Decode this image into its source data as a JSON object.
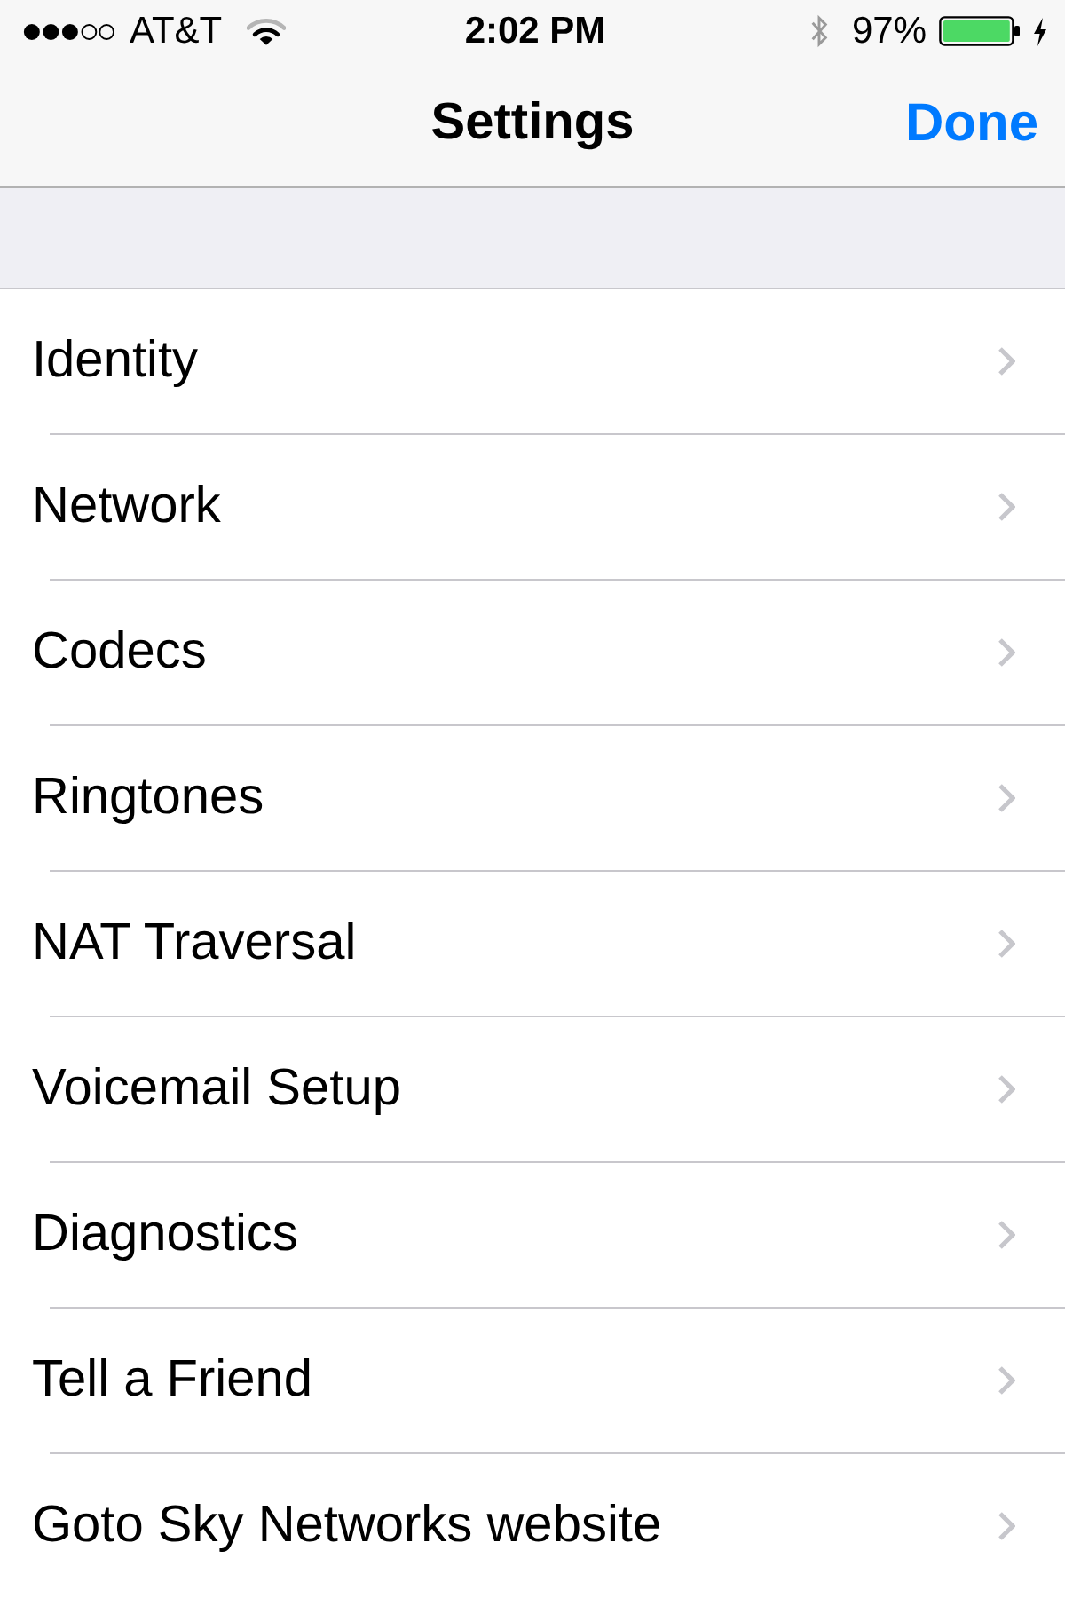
{
  "status_bar": {
    "carrier": "AT&T",
    "time": "2:02 PM",
    "battery": "97%"
  },
  "nav_bar": {
    "title": "Settings",
    "done_button": "Done"
  },
  "items": [
    {
      "label": "Identity"
    },
    {
      "label": "Network"
    },
    {
      "label": "Codecs"
    },
    {
      "label": "Ringtones"
    },
    {
      "label": "NAT Traversal"
    },
    {
      "label": "Voicemail Setup"
    },
    {
      "label": "Diagnostics"
    },
    {
      "label": "Tell a Friend"
    },
    {
      "label": "Goto Sky Networks website"
    }
  ]
}
